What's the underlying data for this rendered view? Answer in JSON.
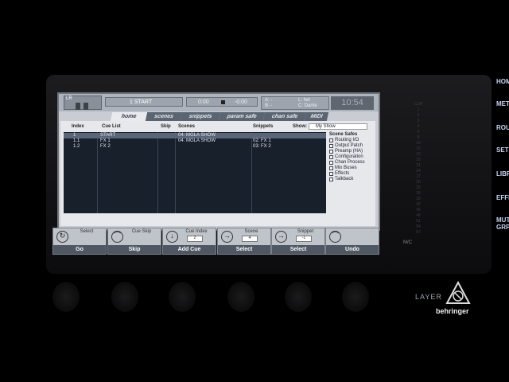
{
  "header": {
    "lr_label": "LR",
    "current_cue": "1 START",
    "time_left": "0:00",
    "time_right": "-0:00",
    "ab_rows": [
      [
        "A:",
        "-",
        "L: ",
        "hel"
      ],
      [
        "B:",
        "-",
        "C:",
        "Dante"
      ]
    ],
    "clock": "10:54"
  },
  "tabs": [
    "home",
    "scenes",
    "snippets",
    "param safe",
    "chan safe",
    "MIDI"
  ],
  "active_tab": "home",
  "columns": {
    "index": "Index",
    "cue_list": "Cue List",
    "skip": "Skip",
    "scenes": "Scenes",
    "snippets": "Snippets"
  },
  "show": {
    "label": "Show:",
    "name": "My Show"
  },
  "rows": [
    {
      "index": "1",
      "cue": "START",
      "scene": "04: MGLA SHOW",
      "snippet": "",
      "selected": true
    },
    {
      "index": "1.1",
      "cue": "FX 1",
      "scene": "04: MGLA SHOW",
      "snippet": "02: FX 1",
      "selected": false
    },
    {
      "index": "1.2",
      "cue": "FX 2",
      "scene": "",
      "snippet": "03: FX 2",
      "selected": false
    }
  ],
  "scene_safes": {
    "title": "Scene Safes",
    "items": [
      "Routing I/O",
      "Output Patch",
      "Preamp (HA)",
      "Configuration",
      "Chan Process",
      "Mix Buses",
      "Effects",
      "Talkback"
    ]
  },
  "softkeys": [
    {
      "icon": "↻",
      "label": "Select",
      "value": "",
      "action": "Go"
    },
    {
      "icon": "⌒",
      "label": "Cue Skip",
      "value": "",
      "action": "Skip"
    },
    {
      "icon": "↓",
      "label": "Cue Index",
      "value": "2",
      "action": "Add Cue"
    },
    {
      "icon": "→",
      "label": "Scene",
      "value": "4",
      "action": "Select"
    },
    {
      "icon": "→",
      "label": "Snippet",
      "value": "-1",
      "action": "Select"
    },
    {
      "icon": "⌒",
      "label": "",
      "value": "",
      "action": "Undo"
    }
  ],
  "meter_labels": [
    "CLIP",
    "1",
    "2",
    "3",
    "4",
    "6",
    "8",
    "10",
    "12",
    "15",
    "18",
    "21",
    "24",
    "27",
    "30",
    "33",
    "36",
    "39",
    "42",
    "45",
    "48",
    "51",
    "54",
    "57"
  ],
  "side_labels": [
    "HOME",
    "METER",
    "ROUTING",
    "SETUP",
    "LIBRARY",
    "EFFECTS",
    "MUTE GRP"
  ],
  "mc_label": "M/C",
  "layer_label": "LAYER",
  "brand": "behringer"
}
